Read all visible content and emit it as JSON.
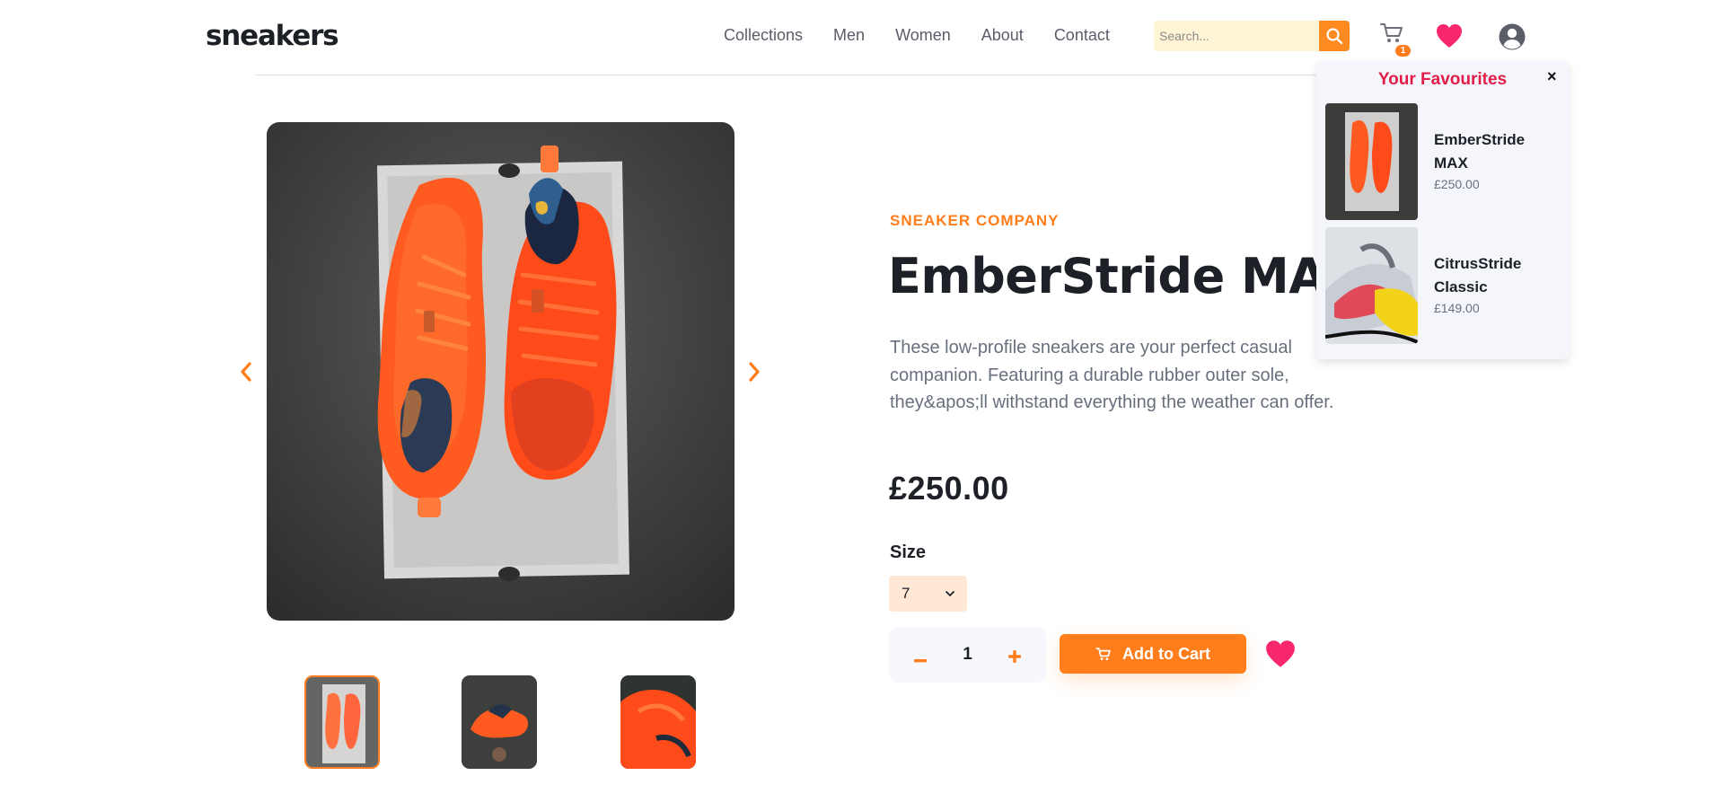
{
  "header": {
    "logo": "sneakers",
    "nav": [
      "Collections",
      "Men",
      "Women",
      "About",
      "Contact"
    ],
    "search_placeholder": "Search...",
    "cart_count": "1",
    "icons": {
      "search": "search-icon",
      "cart": "cart-icon",
      "favourites": "heart-icon",
      "account": "user-icon"
    }
  },
  "product": {
    "company": "SNEAKER COMPANY",
    "name": "EmberStride MAX",
    "description": "These low-profile sneakers are your perfect casual companion. Featuring a durable rubber outer sole, they&apos;ll withstand everything the weather can offer.",
    "price": "£250.00",
    "size_label": "Size",
    "size_selected": "7",
    "quantity": "1",
    "add_to_cart": "Add to Cart",
    "thumbnails_count": 3,
    "active_thumbnail": 1
  },
  "favourites": {
    "title": "Your Favourites",
    "close": "×",
    "items": [
      {
        "name": "EmberStride MAX",
        "price": "£250.00"
      },
      {
        "name": "CitrusStride Classic",
        "price": "£149.00"
      }
    ]
  },
  "colors": {
    "accent": "#ff7e1b",
    "favourites_title": "#e11d48",
    "heart": "#f7266e"
  }
}
